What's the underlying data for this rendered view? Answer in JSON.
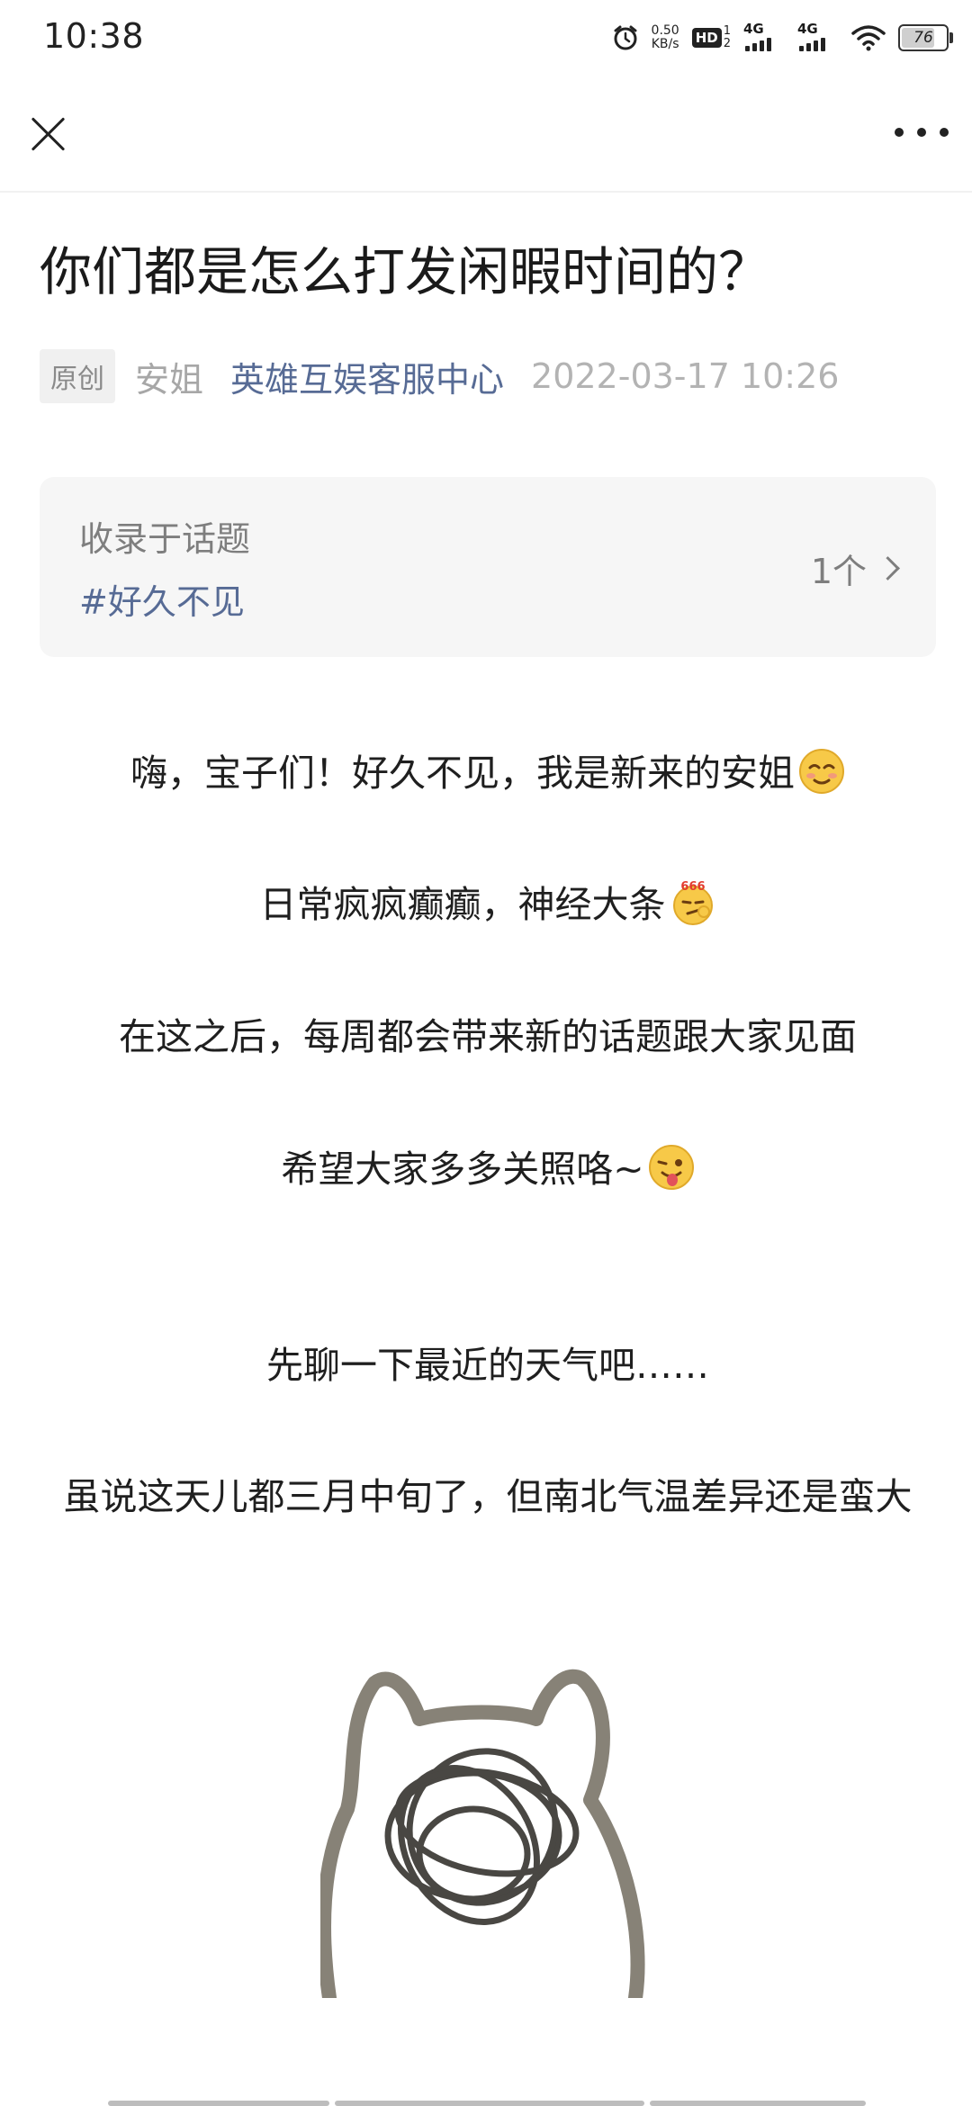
{
  "status_bar": {
    "time": "10:38",
    "net_speed_value": "0.50",
    "net_speed_unit": "KB/s",
    "hd_label": "HD",
    "sim_slot_top": "1",
    "sim_slot_bottom": "2",
    "signal1_label": "4G",
    "signal2_label": "4G",
    "battery_level": "76",
    "icons": [
      "alarm-icon",
      "hd-voice-icon",
      "signal-icon",
      "signal-icon",
      "wifi-icon",
      "battery-icon"
    ]
  },
  "nav": {
    "close_icon": "close-icon",
    "more_icon": "more-icon"
  },
  "article": {
    "title": "你们都是怎么打发闲暇时间的？",
    "original_tag": "原创",
    "author": "安姐",
    "account_name": "英雄互娱客服中心",
    "publish_time": "2022-03-17 10:26"
  },
  "topic": {
    "label": "收录于话题",
    "tag": "#好久不见",
    "count": "1个"
  },
  "body": {
    "p1": "嗨，宝子们！好久不见，我是新来的安姐",
    "p2": "日常疯疯癫癫，神经大条",
    "p3": "在这之后，每周都会带来新的话题跟大家见面",
    "p4": "希望大家多多关照咯~",
    "p5": "先聊一下最近的天气吧……",
    "p6": "虽说这天儿都三月中旬了，但南北气温差异还是蛮大"
  },
  "emoji_badge": "666",
  "colors": {
    "link_blue": "#576b95",
    "meta_gray": "#b3b3b3",
    "card_bg": "#f6f6f6"
  }
}
